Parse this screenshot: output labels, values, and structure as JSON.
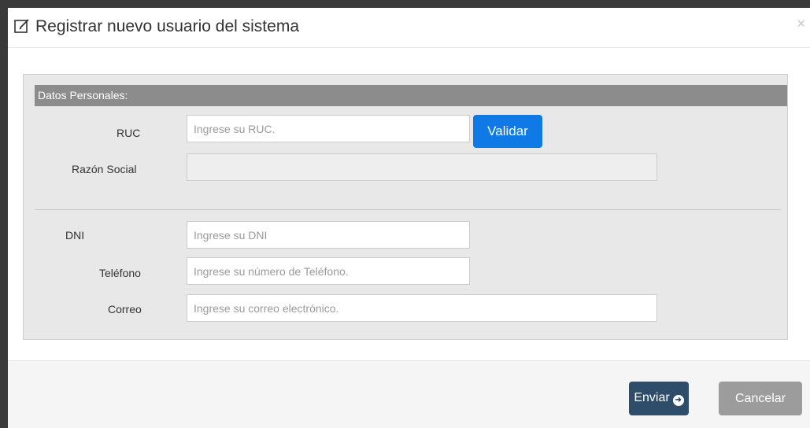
{
  "modal": {
    "title": "Registrar nuevo usuario del sistema",
    "close": "×",
    "title_icon": "edit-icon"
  },
  "section": {
    "header": "Datos Personales:"
  },
  "fields": {
    "ruc": {
      "label": "RUC",
      "placeholder": "Ingrese su RUC.",
      "value": ""
    },
    "razon_social": {
      "label": "Razón Social",
      "value": ""
    },
    "dni": {
      "label": "DNI",
      "placeholder": "Ingrese su DNI",
      "value": ""
    },
    "telefono": {
      "label": "Teléfono",
      "placeholder": "Ingrese su número de Teléfono.",
      "value": ""
    },
    "correo": {
      "label": "Correo",
      "placeholder": "Ingrese su correo electrónico.",
      "value": ""
    }
  },
  "buttons": {
    "validar": "Validar",
    "enviar": "Enviar",
    "enviar_icon": "arrow-circle-right-icon",
    "cancelar": "Cancelar"
  },
  "colors": {
    "primary_blue": "#0f7ae5",
    "enviar_bg": "#2e4d6b",
    "cancelar_bg": "#9c9c9c",
    "section_header_bg": "#8c8c8c",
    "panel_bg": "#e8e8e8"
  }
}
